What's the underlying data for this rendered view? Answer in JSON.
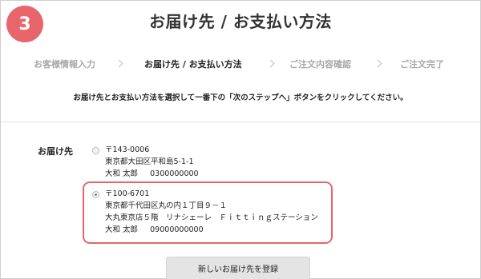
{
  "step_badge": "3",
  "page_title": "お届け先 / お支払い方法",
  "stepper": [
    {
      "label": "お客様情報入力",
      "state": "done"
    },
    {
      "label": "お届け先 / お支払い方法",
      "state": "active"
    },
    {
      "label": "ご注文内容確認",
      "state": "upcoming"
    },
    {
      "label": "ご注文完了",
      "state": "upcoming"
    }
  ],
  "instruction": "お届け先とお支払い方法を選択して一番下の「次のステップへ」ボタンをクリックしてください。",
  "shipping": {
    "label": "お届け先",
    "addresses": [
      {
        "selected": false,
        "postal": "〒143-0006",
        "address": "東京都大田区平和島5-1-1",
        "building": "",
        "name": "大和 太郎",
        "phone": "0300000000"
      },
      {
        "selected": true,
        "postal": "〒100-6701",
        "address": "東京都千代田区丸の内１丁目９－１",
        "building": "大丸東京店５階　リナシェーレ　Ｆｉｔｔｉｎｇステーション",
        "name": "大和 太郎",
        "phone": "09000000000"
      }
    ],
    "add_button_label": "新しいお届け先を登録"
  },
  "colors": {
    "accent": "#e8666b",
    "inactive_step": "#a8a8a8",
    "button_bg": "#e4e4e4"
  }
}
